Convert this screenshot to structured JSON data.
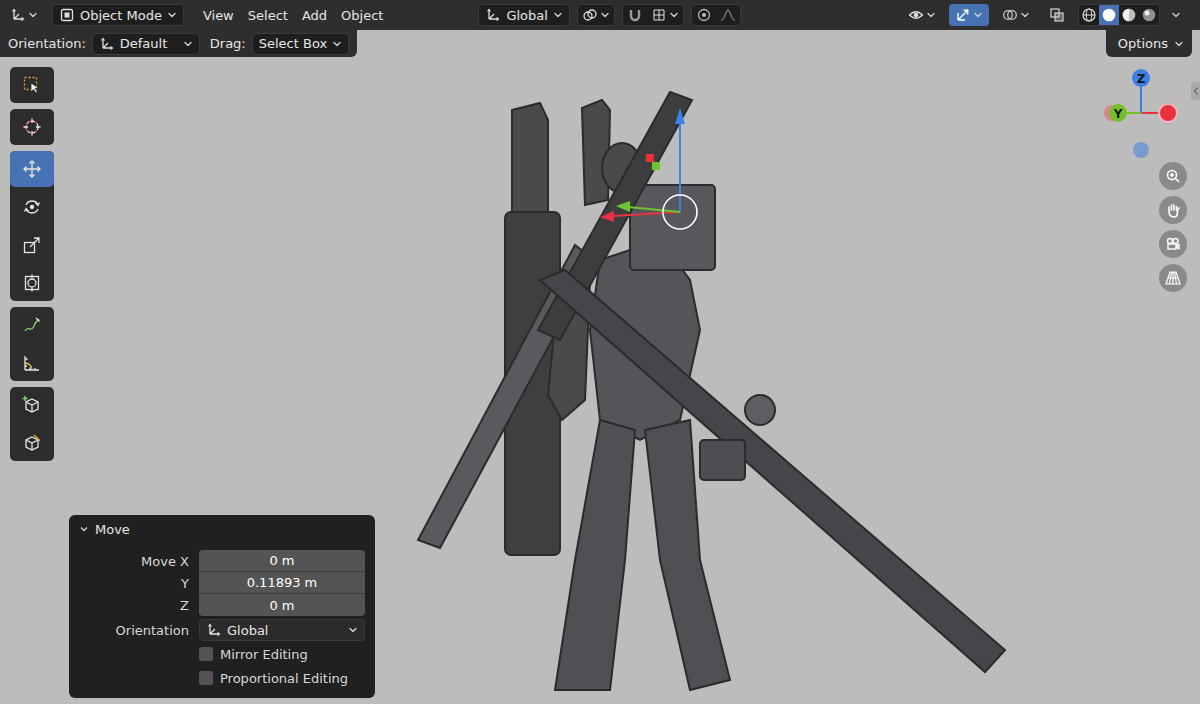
{
  "header": {
    "mode": "Object Mode",
    "menus": [
      "View",
      "Select",
      "Add",
      "Object"
    ],
    "transform_orientation": "Global",
    "snapping": {
      "on": false
    },
    "proportional_editing": {
      "on": false
    },
    "viewport_toggles": [
      {
        "on": false
      },
      {
        "on": true
      },
      {
        "on": false
      },
      {
        "on": false
      }
    ],
    "shading_modes": [
      {
        "selected": false
      },
      {
        "selected": true
      },
      {
        "selected": false
      },
      {
        "selected": false
      }
    ]
  },
  "tool_settings": {
    "orientation_label": "Orientation:",
    "orientation": "Default",
    "drag_label": "Drag:",
    "drag": "Select Box",
    "options": "Options"
  },
  "toolbar": [
    {
      "tools": [
        {
          "selected": false
        }
      ]
    },
    {
      "tools": [
        {
          "selected": false
        }
      ]
    },
    {
      "tools": [
        {
          "selected": true
        },
        {
          "selected": false
        },
        {
          "selected": false
        },
        {
          "selected": false
        }
      ]
    },
    {
      "tools": [
        {
          "selected": false
        },
        {
          "selected": false
        }
      ]
    },
    {
      "tools": [
        {
          "selected": false
        },
        {
          "selected": false
        }
      ]
    }
  ],
  "navigation_gizmo": {
    "axes": [
      {
        "label": "Z",
        "color": "#3c80e6"
      },
      {
        "label": "Y",
        "color": "#74c02a"
      }
    ]
  },
  "operator_panel": {
    "title": "Move",
    "expanded": true,
    "fields": [
      {
        "label": "Move X",
        "value": "0 m"
      },
      {
        "label": "Y",
        "value": "0.11893 m"
      },
      {
        "label": "Z",
        "value": "0 m"
      }
    ],
    "orientation_label": "Orientation",
    "orientation": "Global",
    "options": [
      {
        "label": "Mirror Editing",
        "checked": false
      },
      {
        "label": "Proportional Editing",
        "checked": false
      }
    ]
  }
}
